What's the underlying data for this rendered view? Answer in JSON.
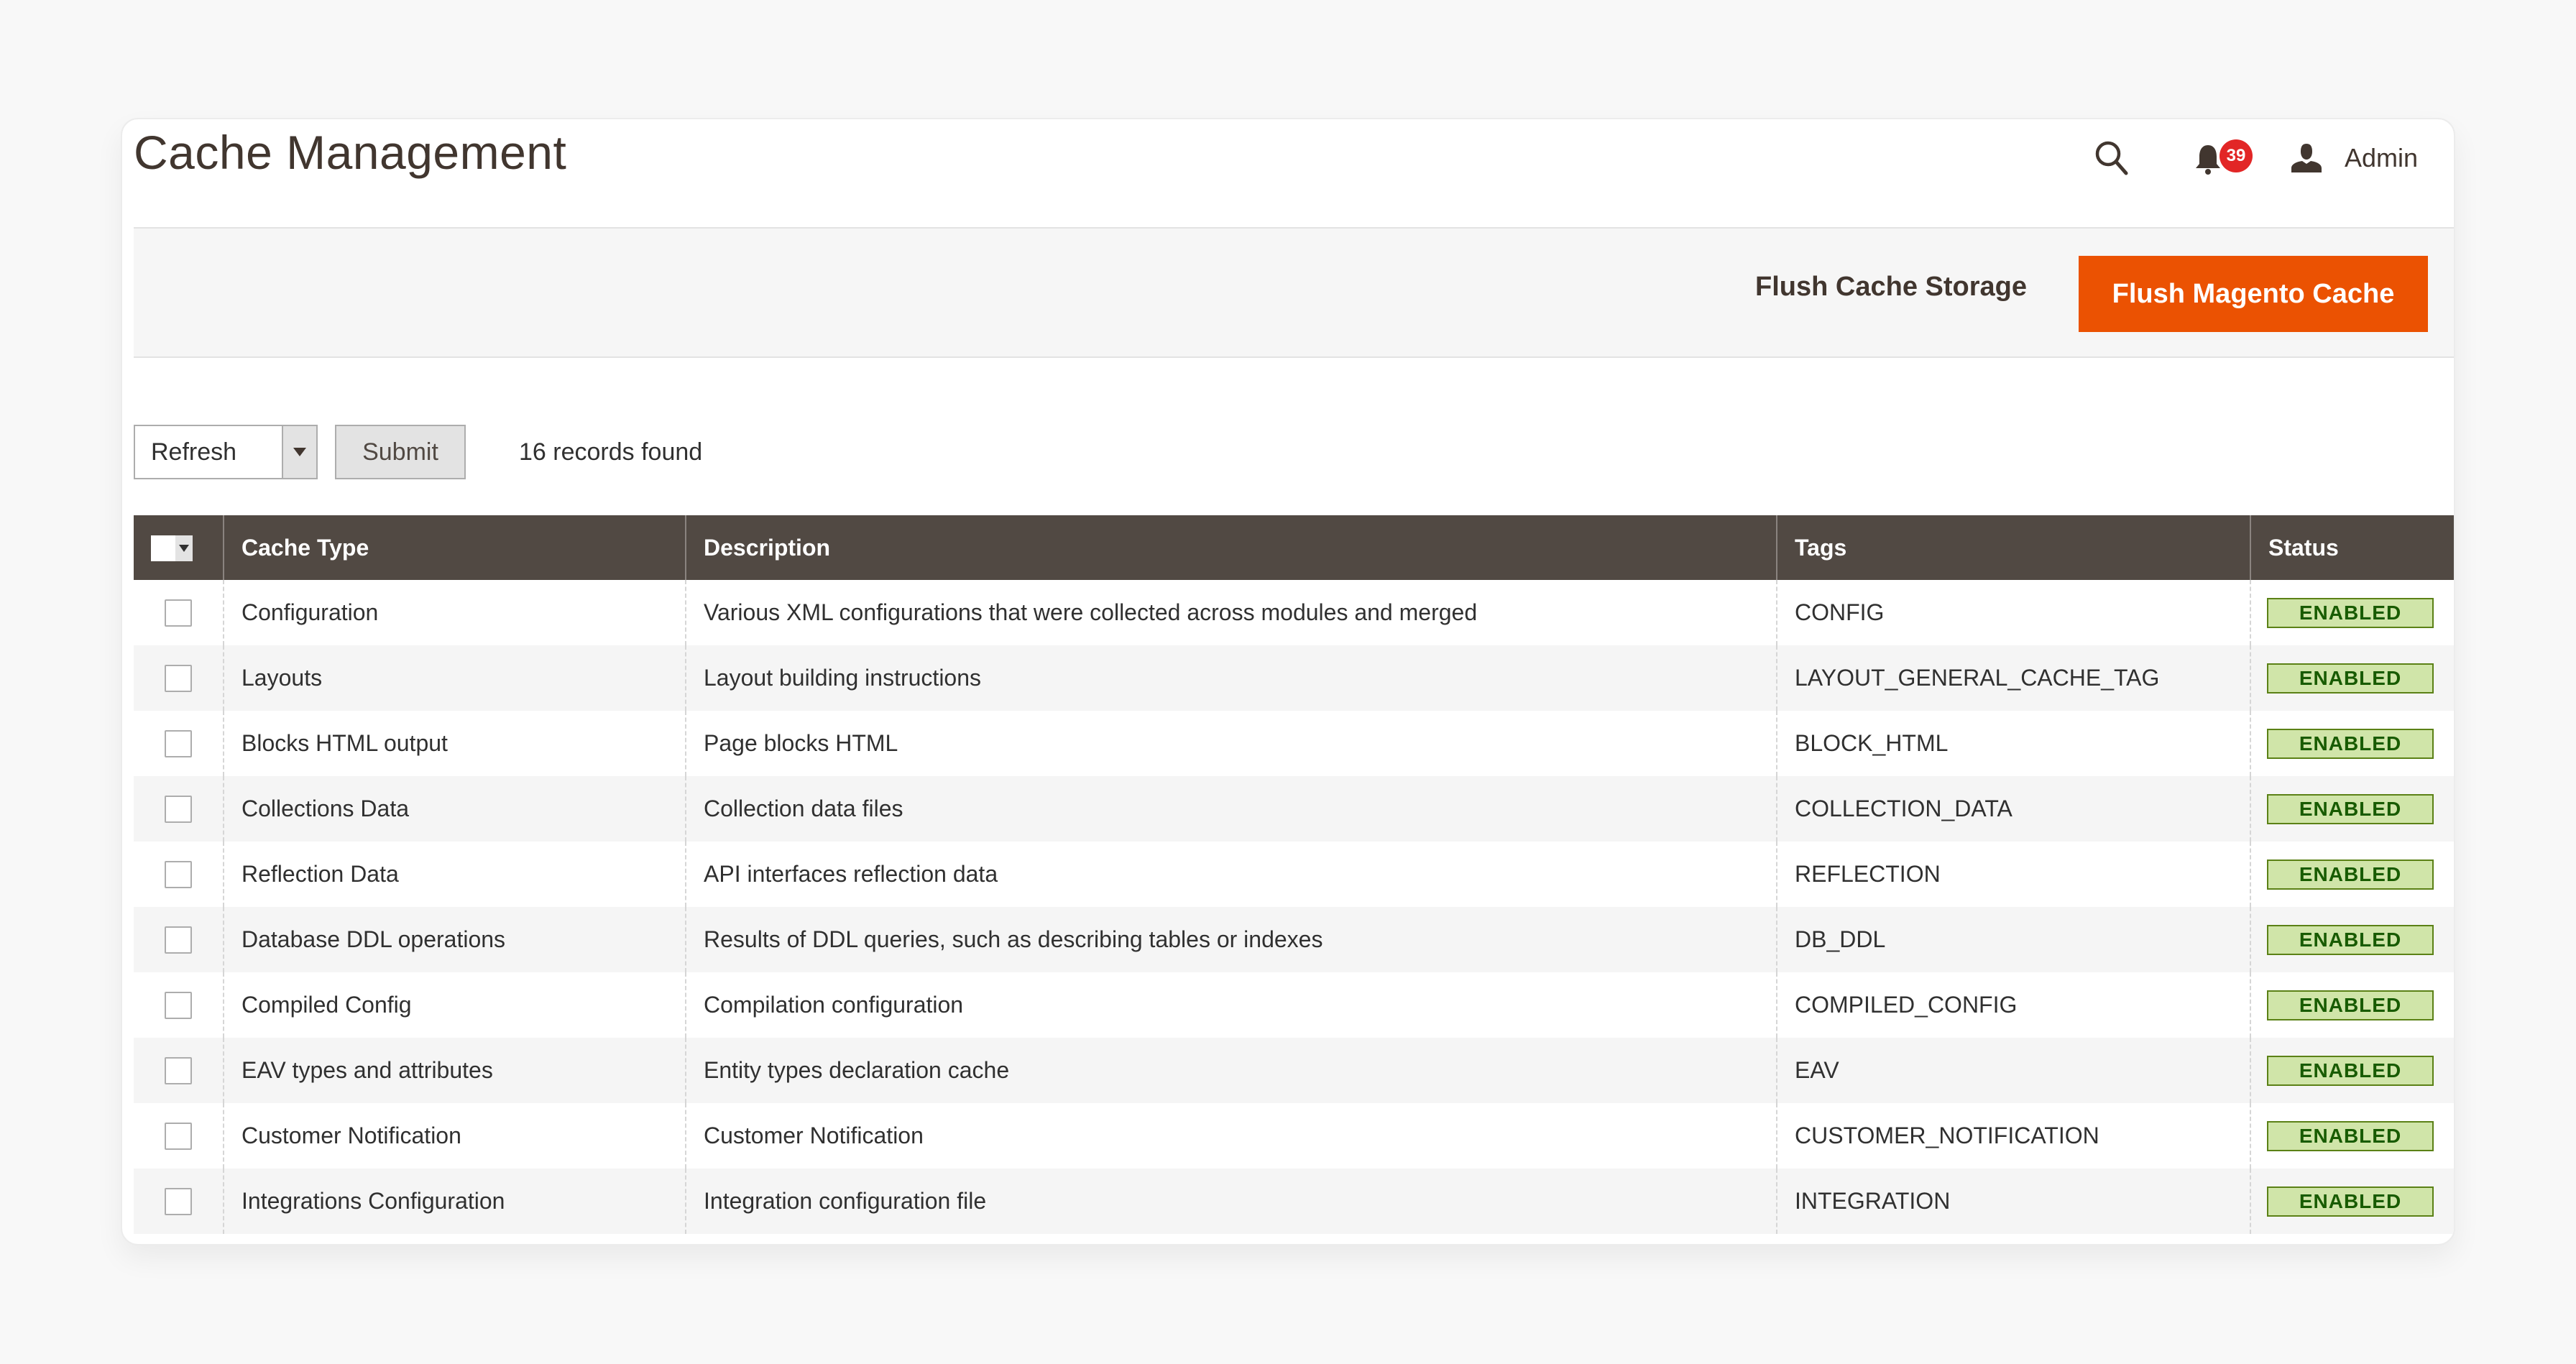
{
  "page": {
    "title": "Cache Management"
  },
  "header": {
    "search_icon": "search-icon",
    "notifications": {
      "icon": "bell-icon",
      "count": "39"
    },
    "user": {
      "icon": "user-icon",
      "name": "Admin"
    }
  },
  "actions": {
    "flush_cache_storage": "Flush Cache Storage",
    "flush_magento_cache": "Flush Magento Cache"
  },
  "colors": {
    "accent": "#eb5202",
    "table_header": "#514943",
    "badge_bg": "#d0e5a9",
    "badge_border": "#5b8116",
    "badge_text": "#185b00",
    "notification_badge": "#e22626"
  },
  "massaction": {
    "selected": "Refresh",
    "submit_label": "Submit",
    "records_found": "16 records found"
  },
  "grid": {
    "columns": [
      "Cache Type",
      "Description",
      "Tags",
      "Status"
    ],
    "rows": [
      {
        "type": "Configuration",
        "description": "Various XML configurations that were collected across modules and merged",
        "tags": "CONFIG",
        "status": "ENABLED"
      },
      {
        "type": "Layouts",
        "description": "Layout building instructions",
        "tags": "LAYOUT_GENERAL_CACHE_TAG",
        "status": "ENABLED"
      },
      {
        "type": "Blocks HTML output",
        "description": "Page blocks HTML",
        "tags": "BLOCK_HTML",
        "status": "ENABLED"
      },
      {
        "type": "Collections Data",
        "description": "Collection data files",
        "tags": "COLLECTION_DATA",
        "status": "ENABLED"
      },
      {
        "type": "Reflection Data",
        "description": "API interfaces reflection data",
        "tags": "REFLECTION",
        "status": "ENABLED"
      },
      {
        "type": "Database DDL operations",
        "description": "Results of DDL queries, such as describing tables or indexes",
        "tags": "DB_DDL",
        "status": "ENABLED"
      },
      {
        "type": "Compiled Config",
        "description": "Compilation configuration",
        "tags": "COMPILED_CONFIG",
        "status": "ENABLED"
      },
      {
        "type": "EAV types and attributes",
        "description": "Entity types declaration cache",
        "tags": "EAV",
        "status": "ENABLED"
      },
      {
        "type": "Customer Notification",
        "description": "Customer Notification",
        "tags": "CUSTOMER_NOTIFICATION",
        "status": "ENABLED"
      },
      {
        "type": "Integrations Configuration",
        "description": "Integration configuration file",
        "tags": "INTEGRATION",
        "status": "ENABLED"
      }
    ]
  }
}
